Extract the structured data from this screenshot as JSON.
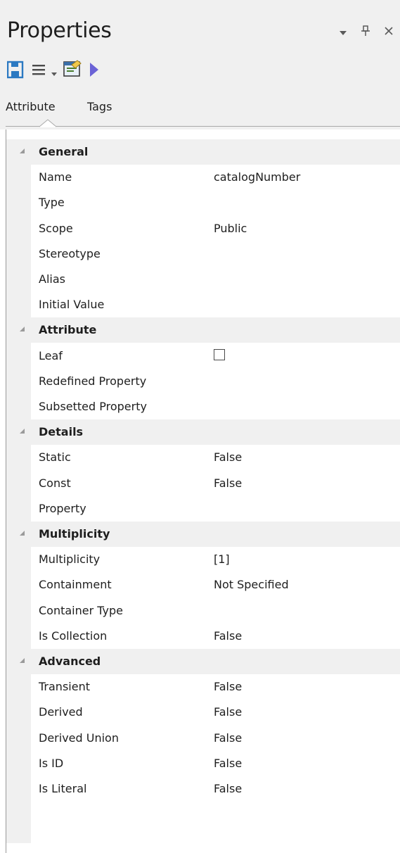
{
  "panel": {
    "title": "Properties"
  },
  "title_buttons": {
    "dropdown_icon": "chevron-down-icon",
    "pin_icon": "pin-icon",
    "close_icon": "close-icon"
  },
  "toolbar": {
    "items": [
      "save-icon",
      "menu-icon",
      "dropdown-arrow-icon",
      "properties-dialog-icon",
      "play-icon"
    ]
  },
  "tabs": [
    {
      "label": "Attribute",
      "active": true
    },
    {
      "label": "Tags",
      "active": false
    }
  ],
  "sections": [
    {
      "title": "General",
      "rows": [
        {
          "label": "Name",
          "value": "catalogNumber"
        },
        {
          "label": "Type",
          "value": ""
        },
        {
          "label": "Scope",
          "value": "Public"
        },
        {
          "label": "Stereotype",
          "value": ""
        },
        {
          "label": "Alias",
          "value": ""
        },
        {
          "label": "Initial Value",
          "value": ""
        }
      ]
    },
    {
      "title": "Attribute",
      "rows": [
        {
          "label": "Leaf",
          "value": "",
          "checkbox": true,
          "checked": false
        },
        {
          "label": "Redefined Property",
          "value": ""
        },
        {
          "label": "Subsetted Property",
          "value": ""
        }
      ]
    },
    {
      "title": "Details",
      "rows": [
        {
          "label": "Static",
          "value": "False"
        },
        {
          "label": "Const",
          "value": "False"
        },
        {
          "label": "Property",
          "value": ""
        }
      ]
    },
    {
      "title": "Multiplicity",
      "rows": [
        {
          "label": "Multiplicity",
          "value": "[1]"
        },
        {
          "label": "Containment",
          "value": "Not Specified"
        },
        {
          "label": "Container Type",
          "value": ""
        },
        {
          "label": "Is Collection",
          "value": "False"
        }
      ]
    },
    {
      "title": "Advanced",
      "rows": [
        {
          "label": "Transient",
          "value": "False"
        },
        {
          "label": "Derived",
          "value": "False"
        },
        {
          "label": "Derived Union",
          "value": "False"
        },
        {
          "label": "Is ID",
          "value": "False"
        },
        {
          "label": "Is Literal",
          "value": "False"
        }
      ]
    }
  ],
  "colors": {
    "panel_bg": "#f0f0f0",
    "save_icon": "#2b79c2",
    "play_icon": "#6b63d6"
  }
}
